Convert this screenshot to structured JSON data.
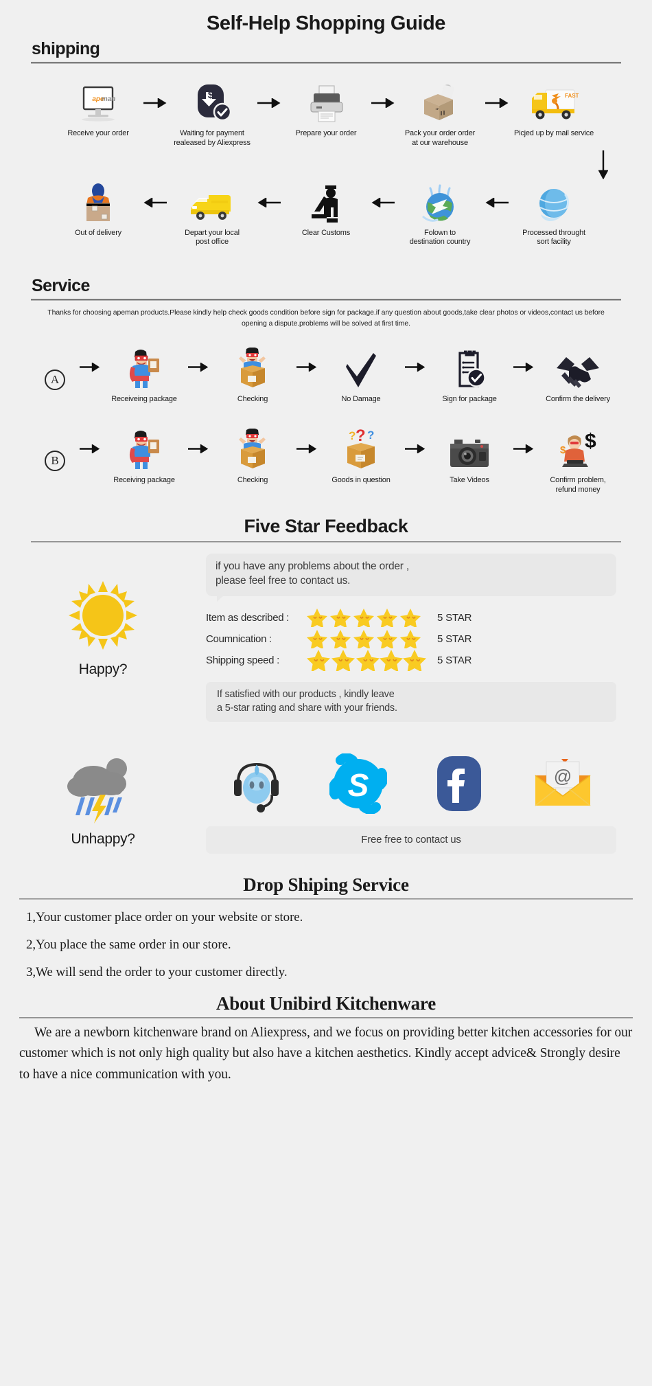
{
  "main_title": "Self-Help Shopping Guide",
  "shipping": {
    "heading": "shipping",
    "row1": [
      {
        "label": "Receive your order",
        "icon": "monitor-apeman-icon"
      },
      {
        "label": "Waiting for payment\nrealeased by Aliexpress",
        "icon": "payment-dollar-icon"
      },
      {
        "label": "Prepare your order",
        "icon": "printer-icon"
      },
      {
        "label": "Pack your order order\nat our warehouse",
        "icon": "packing-box-icon"
      },
      {
        "label": "Picjed up by mail service",
        "icon": "delivery-truck-fast-icon"
      }
    ],
    "row2": [
      {
        "label": "Out of delivery",
        "icon": "courier-box-icon"
      },
      {
        "label": "Depart your local\npost office",
        "icon": "yellow-van-icon"
      },
      {
        "label": "Clear Customs",
        "icon": "customs-officer-icon"
      },
      {
        "label": "Folown to\ndestination country",
        "icon": "globe-plane-icon"
      },
      {
        "label": "Processed throught\nsort facility",
        "icon": "blue-globe-icon"
      }
    ]
  },
  "service": {
    "heading": "Service",
    "note": "Thanks for choosing apeman products.Please kindly help check goods condition before sign for package.if any question about goods,take clear photos or videos,contact us before opening a dispute.problems will be solved at first time.",
    "row_a": {
      "badge": "A",
      "steps": [
        {
          "label": "Receiveing package",
          "icon": "hero-with-parcel-icon"
        },
        {
          "label": "Checking",
          "icon": "hero-opening-box-icon"
        },
        {
          "label": "No Damage",
          "icon": "check-mark-icon"
        },
        {
          "label": "Sign for package",
          "icon": "signed-document-icon"
        },
        {
          "label": "Confirm the delivery",
          "icon": "handshake-icon"
        }
      ]
    },
    "row_b": {
      "badge": "B",
      "steps": [
        {
          "label": "Receiving package",
          "icon": "hero-with-parcel-icon"
        },
        {
          "label": "Checking",
          "icon": "hero-opening-box-icon"
        },
        {
          "label": "Goods in question",
          "icon": "box-question-marks-icon"
        },
        {
          "label": "Take Videos",
          "icon": "camera-icon"
        },
        {
          "label": "Confirm problem,\nrefund money",
          "icon": "refund-agent-icon"
        }
      ]
    }
  },
  "feedback": {
    "heading": "Five Star Feedback",
    "bubble": "if you have any problems about the order ,\nplease feel free to contact us.",
    "happy_label": "Happy?",
    "happy_icon": "sun-icon",
    "ratings": [
      {
        "label": "Item as described :",
        "stars": 5,
        "value": "5 STAR"
      },
      {
        "label": "Coumnication :",
        "stars": 5,
        "value": "5 STAR"
      },
      {
        "label": "Shipping speed :",
        "stars": 5,
        "value": "5 STAR"
      }
    ],
    "note": "If satisfied with our products ,  kindly leave\na 5-star rating and share with your friends.",
    "unhappy_label": "Unhappy?",
    "unhappy_icon": "rain-cloud-icon",
    "socials": [
      {
        "name": "support-headset-icon"
      },
      {
        "name": "skype-icon"
      },
      {
        "name": "facebook-icon"
      },
      {
        "name": "email-envelope-icon"
      }
    ],
    "contact_button": "Free free to contact us"
  },
  "dropship": {
    "heading": "Drop Shiping Service",
    "items": [
      "1,Your customer place order on your website or store.",
      "2,You place the same order in our store.",
      "3,We will send the order to your customer directly."
    ]
  },
  "about": {
    "heading": "About Unibird Kitchenware",
    "text": "We are a newborn kitchenware brand on Aliexpress, and we focus on providing better kitchen accessories for our customer which is not only high quality but also have a kitchen aesthetics. Kindly accept advice& Strongly desire to have a nice communication with you."
  },
  "colors": {
    "background": "#f0f0f0",
    "star_yellow": "#fcd116",
    "skype_blue": "#00aff0",
    "facebook_blue": "#3b5998",
    "truck_yellow": "#f5c518",
    "apeman_orange": "#f0901e"
  }
}
